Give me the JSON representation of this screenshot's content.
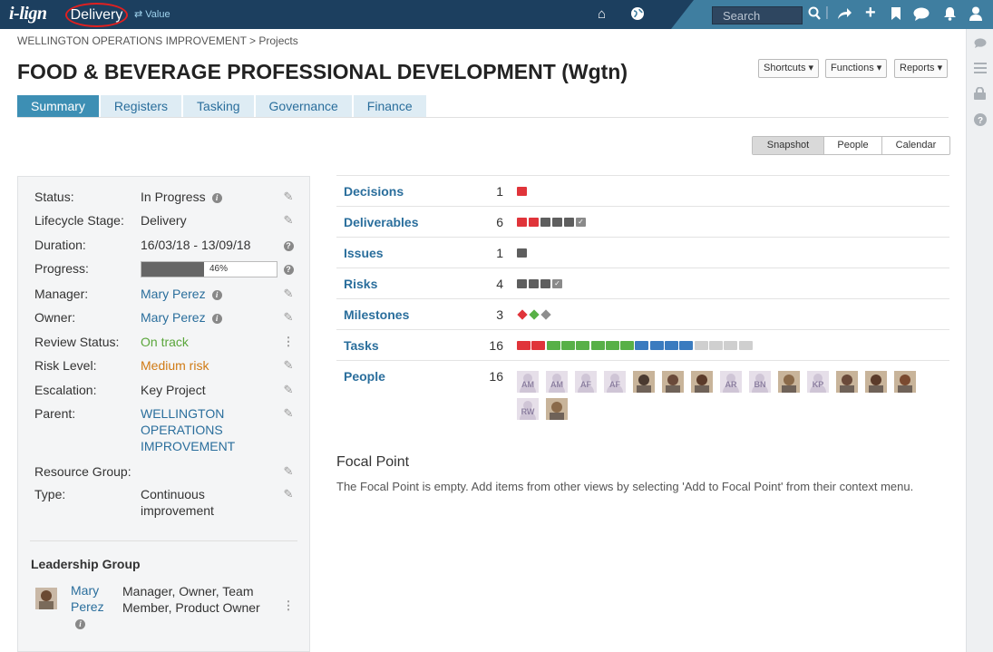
{
  "app": {
    "logo": "i-lign",
    "mode": "Delivery",
    "value_switch": "⇄ Value"
  },
  "topbar": {
    "search_placeholder": "Search"
  },
  "breadcrumb": "WELLINGTON OPERATIONS IMPROVEMENT > Projects",
  "title": "FOOD & BEVERAGE PROFESSIONAL DEVELOPMENT (Wgtn)",
  "header_buttons": {
    "shortcuts": "Shortcuts ▾",
    "functions": "Functions ▾",
    "reports": "Reports ▾"
  },
  "tabs": [
    "Summary",
    "Registers",
    "Tasking",
    "Governance",
    "Finance"
  ],
  "active_tab": "Summary",
  "view_switch": [
    "Snapshot",
    "People",
    "Calendar"
  ],
  "active_view": "Snapshot",
  "details": {
    "status": {
      "label": "Status:",
      "value": "In Progress"
    },
    "lifecycle": {
      "label": "Lifecycle Stage:",
      "value": "Delivery"
    },
    "duration": {
      "label": "Duration:",
      "value": "16/03/18 - 13/09/18"
    },
    "progress": {
      "label": "Progress:",
      "value": "46%",
      "percent": 46
    },
    "manager": {
      "label": "Manager:",
      "value": "Mary Perez"
    },
    "owner": {
      "label": "Owner:",
      "value": "Mary Perez"
    },
    "review": {
      "label": "Review Status:",
      "value": "On track"
    },
    "risk": {
      "label": "Risk Level:",
      "value": "Medium risk"
    },
    "escalation": {
      "label": "Escalation:",
      "value": "Key Project"
    },
    "parent": {
      "label": "Parent:",
      "value": "WELLINGTON OPERATIONS IMPROVEMENT"
    },
    "resource_group": {
      "label": "Resource Group:",
      "value": ""
    },
    "type": {
      "label": "Type:",
      "value": "Continuous improvement"
    }
  },
  "leadership": {
    "title": "Leadership Group",
    "member_name": "Mary Perez",
    "member_roles": "Manager, Owner, Team Member, Product Owner"
  },
  "summary": [
    {
      "name": "Decisions",
      "count": "1",
      "marks": [
        "red"
      ]
    },
    {
      "name": "Deliverables",
      "count": "6",
      "marks": [
        "red",
        "red",
        "gray",
        "gray",
        "gray",
        "check"
      ]
    },
    {
      "name": "Issues",
      "count": "1",
      "marks": [
        "gray"
      ]
    },
    {
      "name": "Risks",
      "count": "4",
      "marks": [
        "gray",
        "gray",
        "gray",
        "check"
      ]
    },
    {
      "name": "Milestones",
      "count": "3",
      "marks": [
        "diamond-red",
        "diamond-green",
        "diamond-gray"
      ]
    },
    {
      "name": "Tasks",
      "count": "16",
      "marks": [
        "red",
        "red",
        "green",
        "green",
        "green",
        "green",
        "green",
        "green",
        "blue",
        "blue",
        "blue",
        "blue",
        "lightgray",
        "lightgray",
        "lightgray",
        "lightgray"
      ]
    },
    {
      "name": "People",
      "count": "16",
      "marks": []
    }
  ],
  "people_avatars": [
    "AM",
    "AM",
    "AF",
    "AF",
    "photo",
    "photo",
    "photo",
    "AR",
    "BN",
    "photo",
    "KP",
    "photo",
    "photo",
    "photo",
    "RW",
    "photo"
  ],
  "colors": {
    "red": "#e0343a",
    "green": "#58b047",
    "blue": "#3a7bbf",
    "gray": "#5e5e5e",
    "lightgray": "#cfcfcf",
    "diamond-gray": "#8e8e8e",
    "tab_active": "#3d8fb4",
    "topbar": "#1c3f5f"
  },
  "focal": {
    "title": "Focal Point",
    "text": "The Focal Point is empty. Add items from other views by selecting 'Add to Focal Point' from their context menu."
  }
}
